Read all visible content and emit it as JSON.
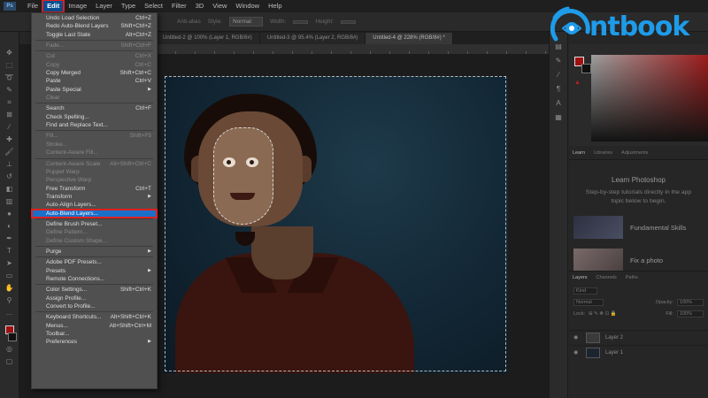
{
  "menubar": {
    "logo": "Ps",
    "items": [
      {
        "label": "File",
        "active": false
      },
      {
        "label": "Edit",
        "active": true
      },
      {
        "label": "Image",
        "active": false
      },
      {
        "label": "Layer",
        "active": false
      },
      {
        "label": "Type",
        "active": false
      },
      {
        "label": "Select",
        "active": false
      },
      {
        "label": "Filter",
        "active": false
      },
      {
        "label": "3D",
        "active": false
      },
      {
        "label": "View",
        "active": false
      },
      {
        "label": "Window",
        "active": false
      },
      {
        "label": "Help",
        "active": false
      }
    ]
  },
  "options_bar": {
    "anti_alias": "Anti-alias",
    "style_label": "Style:",
    "style_value": "Normal",
    "width_label": "Width:",
    "height_label": "Height:"
  },
  "tabs": [
    {
      "label": "Untitled-2 @ 100% (Layer 1, RGB/8#)",
      "active": false
    },
    {
      "label": "Untitled-3 @ 95.4% (Layer 2, RGB/8#)",
      "active": false
    },
    {
      "label": "Untitled-4 @ 228% (RGB/8#) *",
      "active": true
    }
  ],
  "edit_menu": {
    "items": [
      {
        "label": "Undo Load Selection",
        "shortcut": "Ctrl+Z",
        "disabled": false
      },
      {
        "label": "Redo Auto-Blend Layers",
        "shortcut": "Shift+Ctrl+Z",
        "disabled": false
      },
      {
        "label": "Toggle Last State",
        "shortcut": "Alt+Ctrl+Z",
        "disabled": false
      },
      {
        "sep": true
      },
      {
        "label": "Fade...",
        "shortcut": "Shift+Ctrl+F",
        "disabled": true
      },
      {
        "sep": true
      },
      {
        "label": "Cut",
        "shortcut": "Ctrl+X",
        "disabled": true
      },
      {
        "label": "Copy",
        "shortcut": "Ctrl+C",
        "disabled": true
      },
      {
        "label": "Copy Merged",
        "shortcut": "Shift+Ctrl+C",
        "disabled": false
      },
      {
        "label": "Paste",
        "shortcut": "Ctrl+V",
        "disabled": false
      },
      {
        "label": "Paste Special",
        "shortcut": "",
        "submenu": true,
        "disabled": false
      },
      {
        "label": "Clear",
        "shortcut": "",
        "disabled": true
      },
      {
        "sep": true
      },
      {
        "label": "Search",
        "shortcut": "Ctrl+F",
        "disabled": false
      },
      {
        "label": "Check Spelling...",
        "shortcut": "",
        "disabled": false
      },
      {
        "label": "Find and Replace Text...",
        "shortcut": "",
        "disabled": false
      },
      {
        "sep": true
      },
      {
        "label": "Fill...",
        "shortcut": "Shift+F5",
        "disabled": true
      },
      {
        "label": "Stroke...",
        "shortcut": "",
        "disabled": true
      },
      {
        "label": "Content-Aware Fill...",
        "shortcut": "",
        "disabled": true
      },
      {
        "sep": true
      },
      {
        "label": "Content-Aware Scale",
        "shortcut": "Alt+Shift+Ctrl+C",
        "disabled": true
      },
      {
        "label": "Puppet Warp",
        "shortcut": "",
        "disabled": true
      },
      {
        "label": "Perspective Warp",
        "shortcut": "",
        "disabled": true
      },
      {
        "label": "Free Transform",
        "shortcut": "Ctrl+T",
        "disabled": false
      },
      {
        "label": "Transform",
        "shortcut": "",
        "submenu": true,
        "disabled": false
      },
      {
        "label": "Auto-Align Layers...",
        "shortcut": "",
        "disabled": false
      },
      {
        "label": "Auto-Blend Layers...",
        "shortcut": "",
        "disabled": false,
        "highlight": true
      },
      {
        "sep": true
      },
      {
        "label": "Define Brush Preset...",
        "shortcut": "",
        "disabled": false
      },
      {
        "label": "Define Pattern...",
        "shortcut": "",
        "disabled": true
      },
      {
        "label": "Define Custom Shape...",
        "shortcut": "",
        "disabled": true
      },
      {
        "sep": true
      },
      {
        "label": "Purge",
        "shortcut": "",
        "submenu": true,
        "disabled": false
      },
      {
        "sep": true
      },
      {
        "label": "Adobe PDF Presets...",
        "shortcut": "",
        "disabled": false
      },
      {
        "label": "Presets",
        "shortcut": "",
        "submenu": true,
        "disabled": false
      },
      {
        "label": "Remote Connections...",
        "shortcut": "",
        "disabled": false
      },
      {
        "sep": true
      },
      {
        "label": "Color Settings...",
        "shortcut": "Shift+Ctrl+K",
        "disabled": false
      },
      {
        "label": "Assign Profile...",
        "shortcut": "",
        "disabled": false
      },
      {
        "label": "Convert to Profile...",
        "shortcut": "",
        "disabled": false
      },
      {
        "sep": true
      },
      {
        "label": "Keyboard Shortcuts...",
        "shortcut": "Alt+Shift+Ctrl+K",
        "disabled": false
      },
      {
        "label": "Menus...",
        "shortcut": "Alt+Shift+Ctrl+M",
        "disabled": false
      },
      {
        "label": "Toolbar...",
        "shortcut": "",
        "disabled": false
      },
      {
        "label": "Preferences",
        "shortcut": "",
        "submenu": true,
        "disabled": false
      }
    ]
  },
  "learn_panel": {
    "tabs": [
      "Learn",
      "Libraries",
      "Adjustments"
    ],
    "title": "Learn Photoshop",
    "subtitle_line1": "Step-by-step tutorials directly in the app",
    "subtitle_line2": "topic below to begin.",
    "items": [
      "Fundamental Skills",
      "Fix a photo"
    ]
  },
  "layers_panel": {
    "tabs": [
      "Layers",
      "Channels",
      "Paths"
    ],
    "kind_label": "Kind",
    "blend_mode": "Normal",
    "opacity_label": "Opacity:",
    "opacity_value": "100%",
    "lock_label": "Lock:",
    "fill_label": "Fill:",
    "fill_value": "100%",
    "layers": [
      "Layer 2",
      "Layer 1"
    ]
  },
  "brand": {
    "name": "ntbook",
    "color": "#1e9be9"
  },
  "colors": {
    "foreground": "#a01010",
    "menu_highlight": "#1b6fc9",
    "callout": "#e02020"
  }
}
